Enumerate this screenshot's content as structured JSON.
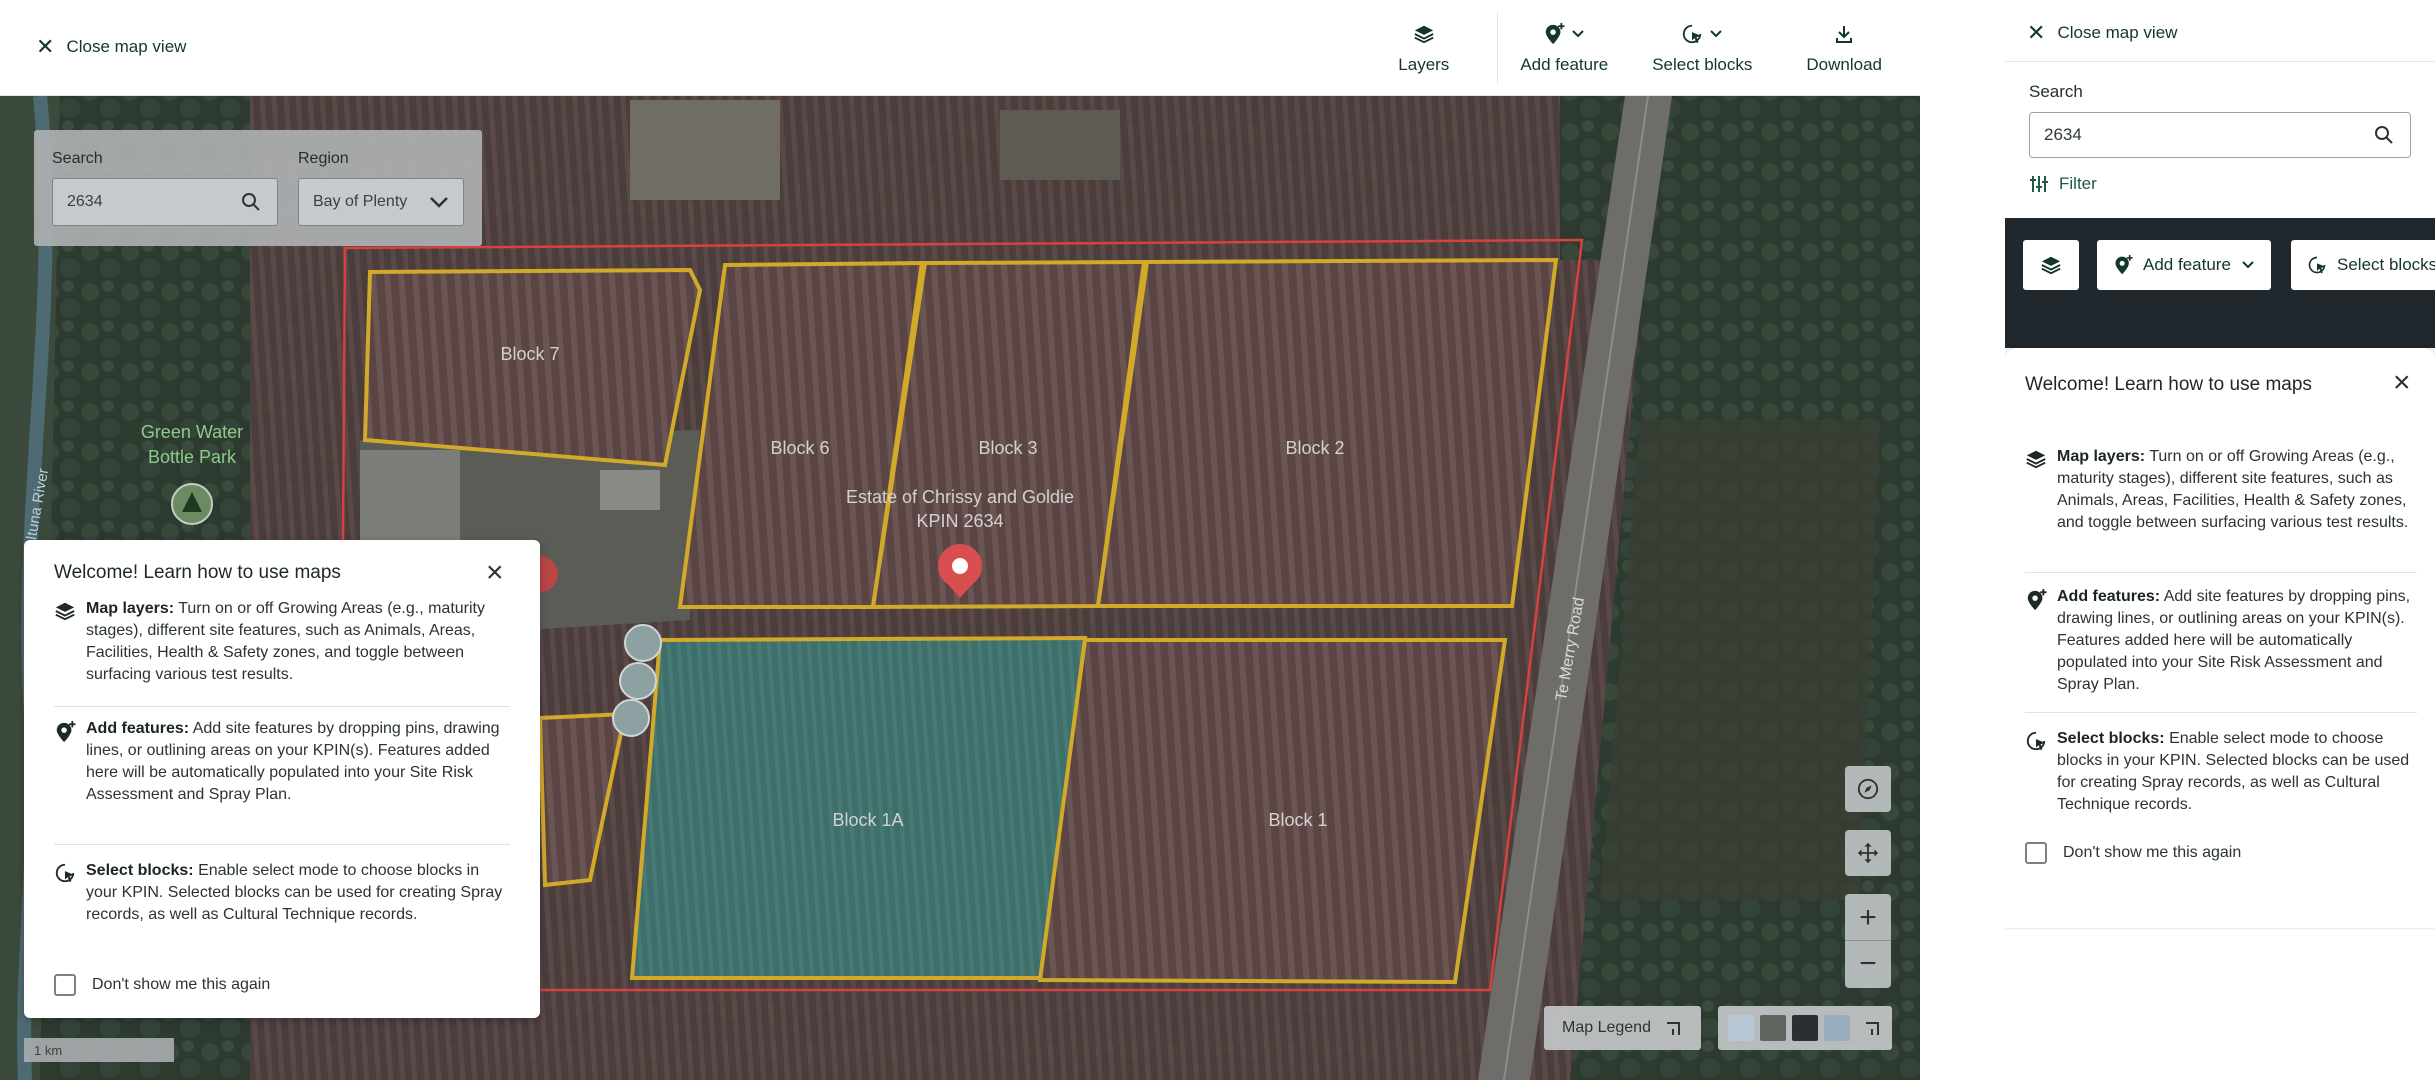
{
  "main": {
    "close_label": "Close map view",
    "toolbar": {
      "layers": "Layers",
      "add_feature": "Add feature",
      "select_blocks": "Select blocks",
      "download": "Download"
    },
    "map_search": {
      "search_label": "Search",
      "search_value": "2634",
      "region_label": "Region",
      "region_value": "Bay of Plenty"
    },
    "map_labels": {
      "block_7": "Block 7",
      "block_6": "Block 6",
      "block_3": "Block 3",
      "block_2": "Block 2",
      "block_1a": "Block 1A",
      "block_1": "Block 1",
      "estate_line1": "Estate of Chrissy and Goldie",
      "estate_line2": "KPIN 2634",
      "park_line1": "Green Water",
      "park_line2": "Bottle Park",
      "road": "Te Merry Road",
      "river": "Ituna River"
    },
    "map_legend": "Map Legend",
    "scale": "1 km"
  },
  "welcome": {
    "title": "Welcome! Learn how to use maps",
    "layers_title": "Map layers:",
    "layers_text": "Turn on or off Growing Areas (e.g., maturity stages), different site features, such as Animals, Areas, Facilities, Health & Safety zones, and toggle between surfacing various test results.",
    "add_title": "Add features:",
    "add_text": "Add site features by dropping pins, drawing lines, or outlining areas on your KPIN(s). Features added here will be automatically populated into your Site Risk Assessment and Spray Plan.",
    "select_title": "Select blocks:",
    "select_text": "Enable select mode to choose blocks in your KPIN. Selected blocks can be used for creating Spray records, as well as Cultural Technique records.",
    "dont_show": "Don't show me this again"
  },
  "panel": {
    "close_label": "Close map view",
    "search_label": "Search",
    "search_value": "2634",
    "filter_label": "Filter",
    "add_feature": "Add feature",
    "select_blocks": "Select blocks"
  },
  "colors": {
    "brand_green": "#14362b",
    "block_outline": "#d3a92a",
    "property_outline": "#d7413f",
    "pin_red": "#d94f4f",
    "dark_bar": "#20282e"
  }
}
